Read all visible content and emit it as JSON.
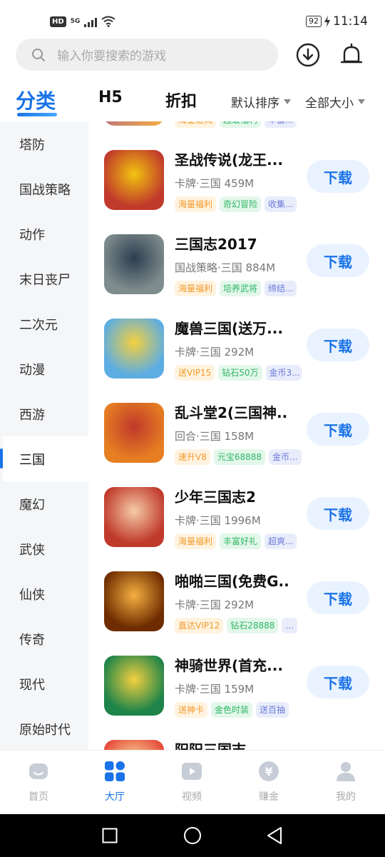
{
  "status_bar": {
    "hd": "HD",
    "network": "5G",
    "battery": "92",
    "time": "11:14"
  },
  "search": {
    "placeholder": "输入你要搜索的游戏"
  },
  "tabs": [
    {
      "label": "分类",
      "active": true
    },
    {
      "label": "H5",
      "active": false
    },
    {
      "label": "折扣",
      "active": false
    }
  ],
  "sort": {
    "order_label": "默认排序",
    "size_label": "全部大小"
  },
  "sidebar": {
    "items": [
      "塔防",
      "国战策略",
      "动作",
      "末日丧尸",
      "二次元",
      "动漫",
      "西游",
      "三国",
      "魔幻",
      "武侠",
      "仙侠",
      "传奇",
      "现代",
      "原始时代"
    ],
    "selected": "三国"
  },
  "partial_top_tags": [
    "海量道具",
    "超级福利",
    "丰富..."
  ],
  "games": [
    {
      "title": "圣战传说(龙王...",
      "meta": "卡牌·三国  459M",
      "tags": [
        {
          "t": "海量福利",
          "c": "orange"
        },
        {
          "t": "奇幻冒险",
          "c": "green"
        },
        {
          "t": "收集...",
          "c": "blue"
        }
      ],
      "button": "下载",
      "icon_colors": [
        "#c0392b",
        "#f1c40f"
      ]
    },
    {
      "title": "三国志2017",
      "meta": "国战策略·三国  884M",
      "tags": [
        {
          "t": "海量福利",
          "c": "orange"
        },
        {
          "t": "培养武将",
          "c": "green"
        },
        {
          "t": "缔结...",
          "c": "blue"
        }
      ],
      "button": "下载",
      "icon_colors": [
        "#7f8c8d",
        "#2c3e50"
      ]
    },
    {
      "title": "魔兽三国(送万...",
      "meta": "卡牌·三国  292M",
      "tags": [
        {
          "t": "送VIP15",
          "c": "orange"
        },
        {
          "t": "钻石50万",
          "c": "green"
        },
        {
          "t": "金币3...",
          "c": "blue"
        }
      ],
      "button": "下载",
      "icon_colors": [
        "#5dade2",
        "#f4d03f"
      ]
    },
    {
      "title": "乱斗堂2(三国神...",
      "meta": "回合·三国  158M",
      "tags": [
        {
          "t": "速升V8",
          "c": "orange"
        },
        {
          "t": "元宝68888",
          "c": "green"
        },
        {
          "t": "金币...",
          "c": "blue"
        }
      ],
      "button": "下载",
      "icon_colors": [
        "#e67e22",
        "#c0392b"
      ]
    },
    {
      "title": "少年三国志2",
      "meta": "卡牌·三国  1996M",
      "tags": [
        {
          "t": "海量福利",
          "c": "orange"
        },
        {
          "t": "丰富好礼",
          "c": "green"
        },
        {
          "t": "超爽...",
          "c": "blue"
        }
      ],
      "button": "下载",
      "icon_colors": [
        "#c0392b",
        "#f5cba7"
      ]
    },
    {
      "title": "啪啪三国(免费G...",
      "meta": "卡牌·三国  292M",
      "tags": [
        {
          "t": "直达VIP12",
          "c": "orange"
        },
        {
          "t": "钻石28888",
          "c": "green"
        },
        {
          "t": "...",
          "c": "blue"
        }
      ],
      "button": "下载",
      "icon_colors": [
        "#6e2c00",
        "#f5b041"
      ]
    },
    {
      "title": "神骑世界(首充...",
      "meta": "卡牌·三国  159M",
      "tags": [
        {
          "t": "送神卡",
          "c": "orange"
        },
        {
          "t": "金色时装",
          "c": "green"
        },
        {
          "t": "送百抽",
          "c": "blue"
        }
      ],
      "button": "下载",
      "icon_colors": [
        "#1e8449",
        "#f4d03f"
      ]
    },
    {
      "title": "阳阳三国志",
      "meta": "",
      "tags": [],
      "button": "",
      "icon_colors": [
        "#e74c3c",
        "#f9e79f"
      ]
    }
  ],
  "bottom_nav": [
    {
      "label": "首页",
      "icon": "home-icon",
      "active": false
    },
    {
      "label": "大厅",
      "icon": "grid-icon",
      "active": true
    },
    {
      "label": "视频",
      "icon": "video-icon",
      "active": false
    },
    {
      "label": "赚金",
      "icon": "coin-icon",
      "active": false
    },
    {
      "label": "我的",
      "icon": "user-icon",
      "active": false
    }
  ],
  "system_nav": [
    "back-icon",
    "home-circle-icon",
    "recent-apps-icon"
  ],
  "colors": {
    "accent": "#1a73e8",
    "sidebar_bg": "#f5f6f8",
    "button_bg": "#e9f3ff"
  }
}
